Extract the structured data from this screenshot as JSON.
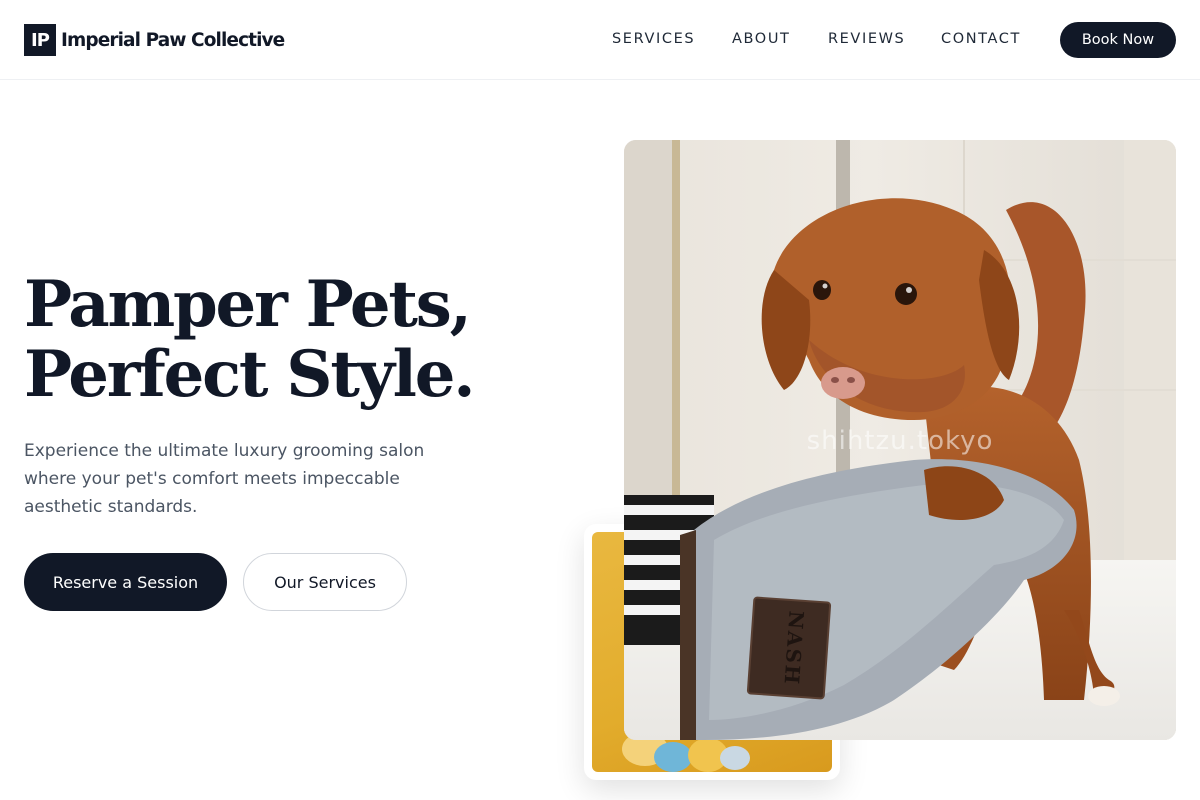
{
  "brand": {
    "mark": "IP",
    "name": "Imperial Paw Collective"
  },
  "nav": {
    "items": [
      "SERVICES",
      "ABOUT",
      "REVIEWS",
      "CONTACT"
    ],
    "cta": "Book Now"
  },
  "hero": {
    "title_lines": [
      "Pamper Pets,",
      "Perfect Style."
    ],
    "subtitle_lines": [
      "Experience the ultimate luxury grooming salon",
      "where your pet's comfort meets impeccable",
      "aesthetic standards."
    ],
    "primary_button": "Reserve a Session",
    "secondary_button": "Our Services"
  },
  "media": {
    "main_photo_watermark": "shihtzu.tokyo",
    "glove_label": "NASH",
    "main_photo_icon": "wet-dog-towel-photo",
    "secondary_photo_icon": "dog-toys-photo"
  },
  "colors": {
    "primary": "#111827",
    "text_muted": "#4b5563",
    "border": "#d1d5db",
    "accent_yellow": "#e2ac2c"
  }
}
